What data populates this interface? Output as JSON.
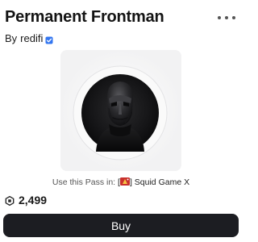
{
  "item": {
    "title": "Permanent Frontman",
    "by_label": "By",
    "creator": "redifi",
    "verified_icon": "verified-badge-icon",
    "more_icon": "more-options-icon",
    "thumbnail_icon": "frontman-mask-image"
  },
  "pass": {
    "prefix": "Use this Pass in:",
    "experience_name": "[🎉] Squid Game X",
    "experience_bracket_open": "[",
    "experience_bracket_close": "]",
    "experience_title": " Squid Game X"
  },
  "price": {
    "currency_icon": "robux-icon",
    "amount": "2,499"
  },
  "buy": {
    "label": "Buy"
  },
  "colors": {
    "buy_background": "#1c1d22",
    "verified_badge": "#3376f0",
    "thumbnail_background": "#f2f2f3"
  }
}
